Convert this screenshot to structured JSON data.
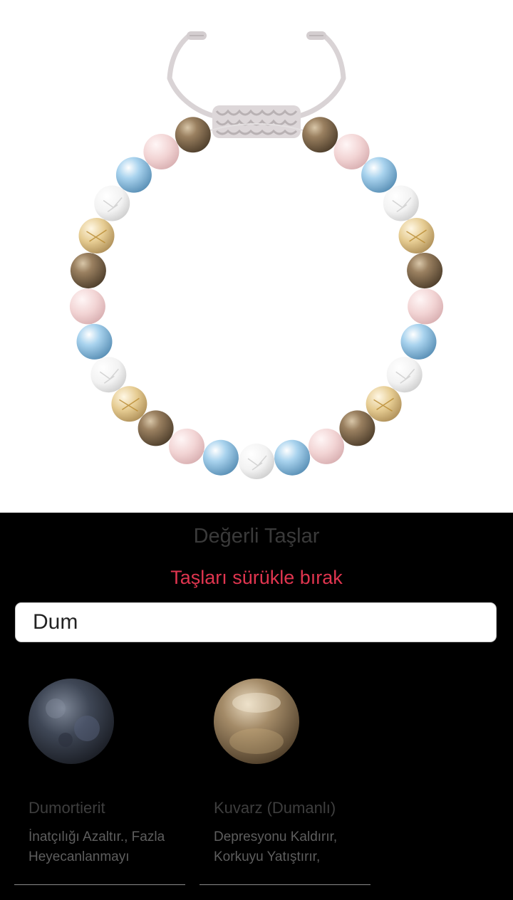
{
  "header": {
    "title": "Değerli Taşlar",
    "hint": "Taşları sürükle bırak"
  },
  "search": {
    "value": "Dum"
  },
  "stones": [
    {
      "name": "Dumortierit",
      "description": "İnatçılığı Azaltır., Fazla Heyecanlanmayı",
      "image": "dumortierite-bead",
      "color": "#3d4553"
    },
    {
      "name": "Kuvarz (Dumanlı)",
      "description": "Depresyonu Kaldırır, Korkuyu Yatıştırır,",
      "image": "smoky-quartz-bead",
      "color": "#8c7556"
    }
  ],
  "bracelet": {
    "image": "beaded-bracelet-preview",
    "cord_color": "#dcd6d8",
    "bead_sequence": [
      "smoky",
      "rose",
      "aqua",
      "crystal",
      "rutile",
      "smoky",
      "rose",
      "aqua",
      "crystal",
      "rutile",
      "smoky",
      "rose",
      "aqua",
      "crystal",
      "aqua",
      "rose",
      "smoky",
      "rutile",
      "crystal",
      "aqua",
      "rose",
      "smoky",
      "rutile",
      "crystal",
      "aqua",
      "rose",
      "smoky"
    ],
    "bead_colors": {
      "smoky": "#7a6448",
      "rose": "#f0d2d2",
      "aqua": "#8fc4e4",
      "crystal": "#f1f1f1",
      "rutile": "#e3c88c"
    }
  }
}
